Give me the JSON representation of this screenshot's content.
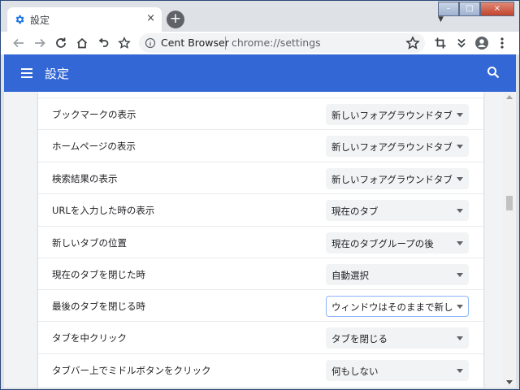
{
  "window": {
    "tab_title": "設定",
    "tab_close": "×",
    "newtab": "+",
    "tabstrip_arrow": "▼",
    "controls": {
      "minimize": "–",
      "maximize": "□",
      "close": "×"
    }
  },
  "toolbar": {
    "site_name": "Cent Browser",
    "url": "chrome://settings"
  },
  "appbar": {
    "title": "設定"
  },
  "settings": [
    {
      "label": "ブックマークの表示",
      "value": "新しいフォアグラウンドタブ"
    },
    {
      "label": "ホームページの表示",
      "value": "新しいフォアグラウンドタブ"
    },
    {
      "label": "検索結果の表示",
      "value": "新しいフォアグラウンドタブ"
    },
    {
      "label": "URLを入力した時の表示",
      "value": "現在のタブ"
    },
    {
      "label": "新しいタブの位置",
      "value": "現在のタブグループの後"
    },
    {
      "label": "現在のタブを閉じた時",
      "value": "自動選択"
    },
    {
      "label": "最後のタブを閉じる時",
      "value": "ウィンドウはそのままで新しいタブ"
    },
    {
      "label": "タブを中クリック",
      "value": "タブを閉じる"
    },
    {
      "label": "タブバー上でミドルボタンをクリック",
      "value": "何もしない"
    }
  ],
  "colors": {
    "accent": "#3367d6",
    "content_bg": "#f1f3f4",
    "focus_ring": "#8ab4f8"
  }
}
